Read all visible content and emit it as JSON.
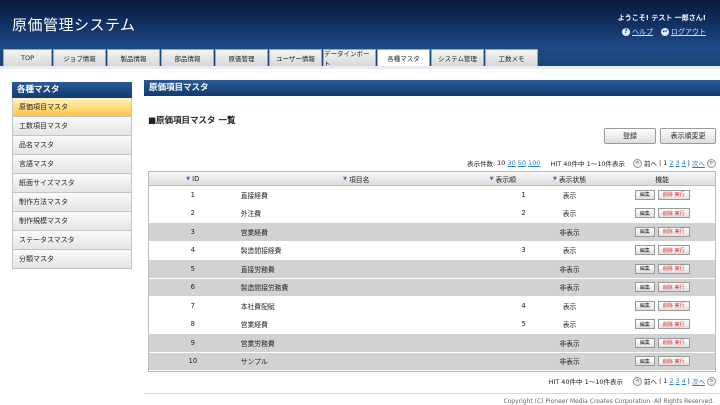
{
  "header": {
    "app_title": "原価管理システム",
    "welcome": "ようこそ! テスト 一郎さん!",
    "help_label": "ヘルプ",
    "logout_label": "ログアウト"
  },
  "tabs": [
    {
      "label": "TOP"
    },
    {
      "label": "ジョブ情報"
    },
    {
      "label": "製品情報"
    },
    {
      "label": "部品情報"
    },
    {
      "label": "原価管理"
    },
    {
      "label": "ユーザー情報"
    },
    {
      "label": "データインポート"
    },
    {
      "label": "各種マスタ"
    },
    {
      "label": "システム管理"
    },
    {
      "label": "工数メモ"
    }
  ],
  "sidebar": {
    "title": "各種マスタ",
    "items": [
      {
        "label": "原価項目マスタ"
      },
      {
        "label": "工数項目マスタ"
      },
      {
        "label": "品名マスタ"
      },
      {
        "label": "言語マスタ"
      },
      {
        "label": "紙面サイズマスタ"
      },
      {
        "label": "制作方法マスタ"
      },
      {
        "label": "制作規模マスタ"
      },
      {
        "label": "ステータスマスタ"
      },
      {
        "label": "分類マスタ"
      }
    ]
  },
  "main": {
    "title": "原価項目マスタ",
    "section_title": "■原価項目マスタ 一覧",
    "register_label": "登録",
    "order_change_label": "表示順変更",
    "display_count_label": "表示件数:",
    "display_counts": [
      "10",
      "30",
      "50",
      "100"
    ],
    "hit_text": "HIT 40件中 1〜10件表示",
    "prev_label": "前へ",
    "next_label": "次へ",
    "pages": [
      "1",
      "2",
      "3",
      "4"
    ],
    "sep": "|"
  },
  "table": {
    "headers": {
      "id": "ID",
      "name": "項目名",
      "order": "表示順",
      "status": "表示状態",
      "func": "機能"
    },
    "edit_label": "編集",
    "delete_label": "削除 実行",
    "rows": [
      {
        "id": "1",
        "name": "直接経費",
        "order": "1",
        "status": "表示"
      },
      {
        "id": "2",
        "name": "外注費",
        "order": "2",
        "status": "表示"
      },
      {
        "id": "3",
        "name": "営業経費",
        "order": "",
        "status": "非表示"
      },
      {
        "id": "4",
        "name": "製造間接経費",
        "order": "3",
        "status": "表示"
      },
      {
        "id": "5",
        "name": "直接労務費",
        "order": "",
        "status": "非表示"
      },
      {
        "id": "6",
        "name": "製造間接労務費",
        "order": "",
        "status": "非表示"
      },
      {
        "id": "7",
        "name": "本社費配賦",
        "order": "4",
        "status": "表示"
      },
      {
        "id": "8",
        "name": "営業経費",
        "order": "5",
        "status": "表示"
      },
      {
        "id": "9",
        "name": "営業労務費",
        "order": "",
        "status": "非表示"
      },
      {
        "id": "10",
        "name": "サンプル",
        "order": "",
        "status": "非表示"
      }
    ]
  },
  "footer": {
    "copyright": "Copyright (C) Pioneer Media Creates Corporation. All Rights Reserved."
  }
}
